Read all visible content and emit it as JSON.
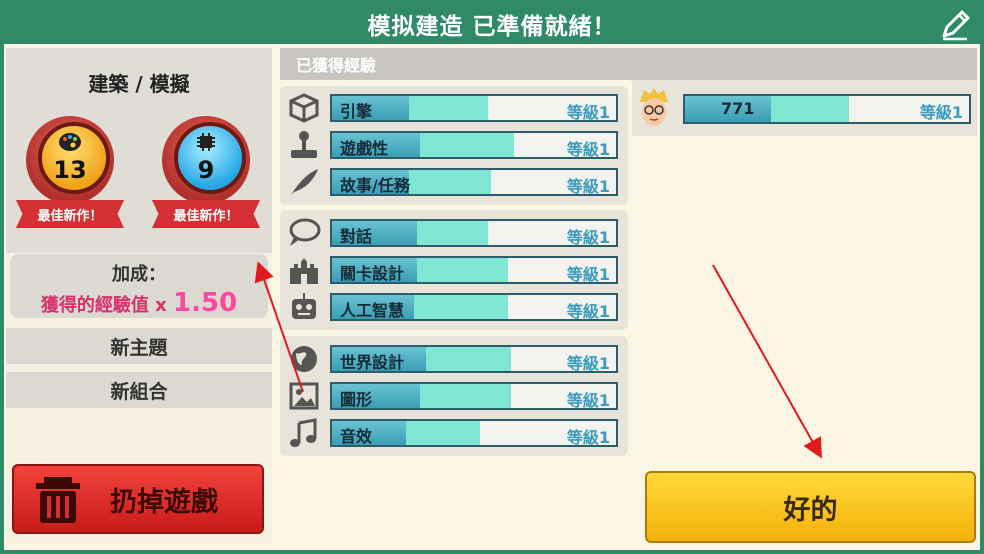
{
  "title": "模拟建造 已準備就緒！",
  "left": {
    "header": "建築 / 模擬",
    "badges": [
      {
        "value": "13",
        "ribbon": "最佳新作！",
        "icon": "palette-icon",
        "color": "#f2a21a"
      },
      {
        "value": "9",
        "ribbon": "最佳新作！",
        "icon": "chip-icon",
        "color": "#27a6e6"
      }
    ],
    "bonus": {
      "label": "加成：",
      "text": "獲得的經驗值",
      "mult": "x",
      "value": "1.50"
    },
    "options": [
      "新主題",
      "新組合"
    ],
    "trash_label": "扔掉遊戲"
  },
  "experience": {
    "header": "已獲得經驗",
    "groups": [
      {
        "rows": [
          {
            "label": "引擎",
            "level": "等級1",
            "icon": "engine-icon",
            "dark": 0.27,
            "light": 0.28
          },
          {
            "label": "遊戲性",
            "level": "等級1",
            "icon": "joystick-icon",
            "dark": 0.31,
            "light": 0.33
          },
          {
            "label": "故事/任務",
            "level": "等級1",
            "icon": "quill-icon",
            "dark": 0.27,
            "light": 0.29
          }
        ]
      },
      {
        "rows": [
          {
            "label": "對話",
            "level": "等級1",
            "icon": "speech-bubble-icon",
            "dark": 0.3,
            "light": 0.25
          },
          {
            "label": "關卡設計",
            "level": "等級1",
            "icon": "castle-icon",
            "dark": 0.3,
            "light": 0.32
          },
          {
            "label": "人工智慧",
            "level": "等級1",
            "icon": "robot-icon",
            "dark": 0.29,
            "light": 0.33
          }
        ]
      },
      {
        "rows": [
          {
            "label": "世界設計",
            "level": "等級1",
            "icon": "globe-icon",
            "dark": 0.33,
            "light": 0.3
          },
          {
            "label": "圖形",
            "level": "等級1",
            "icon": "picture-icon",
            "dark": 0.31,
            "light": 0.32
          },
          {
            "label": "音效",
            "level": "等級1",
            "icon": "music-note-icon",
            "dark": 0.26,
            "light": 0.26
          }
        ]
      }
    ]
  },
  "staff": {
    "value": "771",
    "level": "等級1"
  },
  "ok_label": "好的",
  "colors": {
    "frame": "#2f8a68",
    "ok": "#f4b10b",
    "trash": "#d32f34",
    "bonus": "#ff47a2",
    "bar": "#7ee6d2"
  }
}
